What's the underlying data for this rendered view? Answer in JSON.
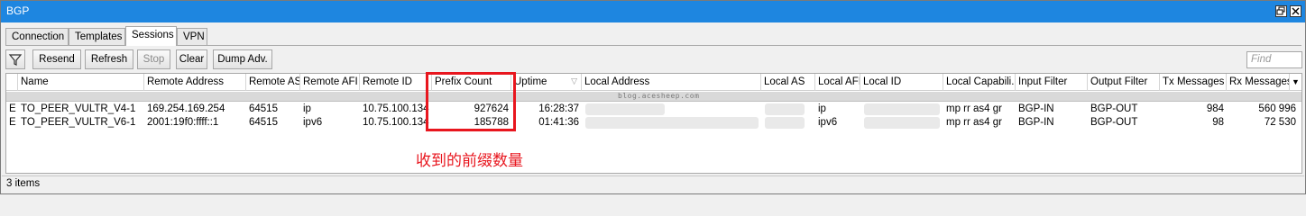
{
  "window": {
    "title": "BGP"
  },
  "tabs": [
    {
      "label": "Connection"
    },
    {
      "label": "Templates"
    },
    {
      "label": "Sessions"
    },
    {
      "label": "VPN"
    }
  ],
  "active_tab": "Sessions",
  "toolbar": {
    "resend_label": "Resend",
    "refresh_label": "Refresh",
    "stop_label": "Stop",
    "clear_label": "Clear",
    "dump_label": "Dump Adv.",
    "find_placeholder": "Find"
  },
  "table": {
    "columns": [
      "Name",
      "Remote Address",
      "Remote AS",
      "Remote AFI",
      "Remote ID",
      "Prefix Count",
      "Uptime",
      "Local Address",
      "Local AS",
      "Local AFI",
      "Local ID",
      "Local Capabili...",
      "Input Filter",
      "Output Filter",
      "Tx Messages",
      "Rx Messages"
    ],
    "comment_watermark": "blog.acesheep.com",
    "rows": [
      {
        "flag": "E",
        "name": "TO_PEER_VULTR_V4-1",
        "remote_address": "169.254.169.254",
        "remote_as": "64515",
        "remote_afi": "ip",
        "remote_id": "10.75.100.134",
        "prefix_count": "927624",
        "uptime": "16:28:37",
        "local_afi": "ip",
        "local_capabilities": "mp rr as4 gr",
        "input_filter": "BGP-IN",
        "output_filter": "BGP-OUT",
        "tx_messages": "984",
        "rx_messages": "560 996"
      },
      {
        "flag": "E",
        "name": "TO_PEER_VULTR_V6-1",
        "remote_address": "2001:19f0:ffff::1",
        "remote_as": "64515",
        "remote_afi": "ipv6",
        "remote_id": "10.75.100.134",
        "prefix_count": "185788",
        "uptime": "01:41:36",
        "local_afi": "ipv6",
        "local_capabilities": "mp rr as4 gr",
        "input_filter": "BGP-IN",
        "output_filter": "BGP-OUT",
        "tx_messages": "98",
        "rx_messages": "72 530"
      }
    ]
  },
  "annotation": "收到的前缀数量",
  "status": "3 items",
  "colors": {
    "titlebar": "#1e86e0",
    "highlight": "#e8161e"
  }
}
